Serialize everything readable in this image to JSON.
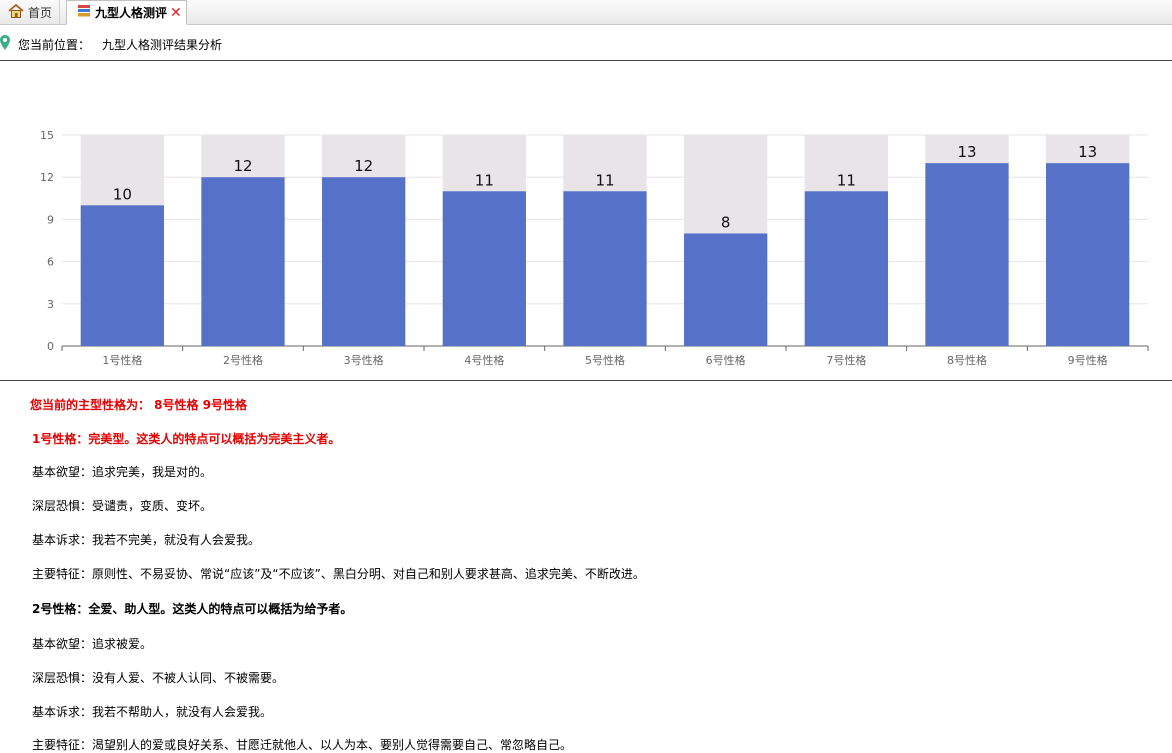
{
  "tabs": {
    "home_label": "首页",
    "active_label": "九型人格测评"
  },
  "breadcrumb": {
    "prefix": "您当前位置：",
    "path": "九型人格测评结果分析"
  },
  "colors": {
    "bar": "#5672c8",
    "bar_bg": "#e8e4e7",
    "accent_red": "#e60000"
  },
  "chart_data": {
    "type": "bar",
    "categories": [
      "1号性格",
      "2号性格",
      "3号性格",
      "4号性格",
      "5号性格",
      "6号性格",
      "7号性格",
      "8号性格",
      "9号性格"
    ],
    "values": [
      10,
      12,
      12,
      11,
      11,
      8,
      11,
      13,
      13
    ],
    "ylim": [
      0,
      15
    ],
    "yticks": [
      0,
      3,
      6,
      9,
      12,
      15
    ],
    "title": "",
    "xlabel": "",
    "ylabel": "",
    "grid": true,
    "background_bars": true
  },
  "results": {
    "main_type_label": "您当前的主型性格为：   8号性格  9号性格",
    "type1_title": "1号性格：完美型。这类人的特点可以概括为完美主义者。",
    "type1_desire": "基本欲望：追求完美，我是对的。",
    "type1_fear": "深层恐惧：受谴责，变质、变坏。",
    "type1_appeal": "基本诉求：我若不完美，就没有人会爱我。",
    "type1_traits": "主要特征：原则性、不易妥协、常说“应该”及“不应该”、黑白分明、对自己和别人要求甚高、追求完美、不断改进。",
    "type2_title": "2号性格：全爱、助人型。这类人的特点可以概括为给予者。",
    "type2_desire": "基本欲望：追求被爱。",
    "type2_fear": "深层恐惧：没有人爱、不被人认同、不被需要。",
    "type2_appeal": "基本诉求：我若不帮助人，就没有人会爱我。",
    "type2_traits": "主要特征：渴望别人的爱或良好关系、甘愿迁就他人、以人为本、要别人觉得需要自己、常忽略自己。"
  }
}
